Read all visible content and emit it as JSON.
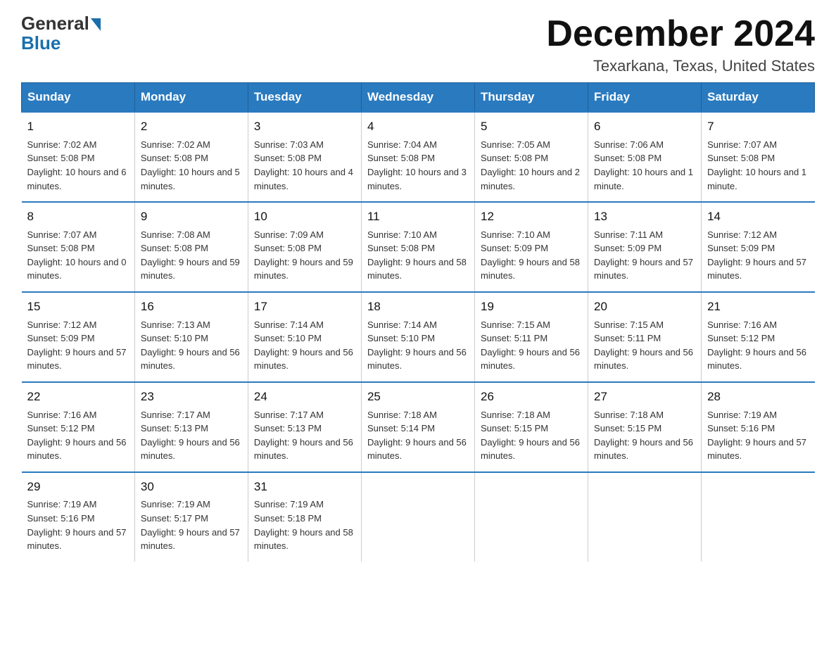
{
  "logo": {
    "general": "General",
    "blue": "Blue"
  },
  "header": {
    "month": "December 2024",
    "location": "Texarkana, Texas, United States"
  },
  "days_of_week": [
    "Sunday",
    "Monday",
    "Tuesday",
    "Wednesday",
    "Thursday",
    "Friday",
    "Saturday"
  ],
  "weeks": [
    [
      {
        "num": "1",
        "sunrise": "7:02 AM",
        "sunset": "5:08 PM",
        "daylight": "10 hours and 6 minutes."
      },
      {
        "num": "2",
        "sunrise": "7:02 AM",
        "sunset": "5:08 PM",
        "daylight": "10 hours and 5 minutes."
      },
      {
        "num": "3",
        "sunrise": "7:03 AM",
        "sunset": "5:08 PM",
        "daylight": "10 hours and 4 minutes."
      },
      {
        "num": "4",
        "sunrise": "7:04 AM",
        "sunset": "5:08 PM",
        "daylight": "10 hours and 3 minutes."
      },
      {
        "num": "5",
        "sunrise": "7:05 AM",
        "sunset": "5:08 PM",
        "daylight": "10 hours and 2 minutes."
      },
      {
        "num": "6",
        "sunrise": "7:06 AM",
        "sunset": "5:08 PM",
        "daylight": "10 hours and 1 minute."
      },
      {
        "num": "7",
        "sunrise": "7:07 AM",
        "sunset": "5:08 PM",
        "daylight": "10 hours and 1 minute."
      }
    ],
    [
      {
        "num": "8",
        "sunrise": "7:07 AM",
        "sunset": "5:08 PM",
        "daylight": "10 hours and 0 minutes."
      },
      {
        "num": "9",
        "sunrise": "7:08 AM",
        "sunset": "5:08 PM",
        "daylight": "9 hours and 59 minutes."
      },
      {
        "num": "10",
        "sunrise": "7:09 AM",
        "sunset": "5:08 PM",
        "daylight": "9 hours and 59 minutes."
      },
      {
        "num": "11",
        "sunrise": "7:10 AM",
        "sunset": "5:08 PM",
        "daylight": "9 hours and 58 minutes."
      },
      {
        "num": "12",
        "sunrise": "7:10 AM",
        "sunset": "5:09 PM",
        "daylight": "9 hours and 58 minutes."
      },
      {
        "num": "13",
        "sunrise": "7:11 AM",
        "sunset": "5:09 PM",
        "daylight": "9 hours and 57 minutes."
      },
      {
        "num": "14",
        "sunrise": "7:12 AM",
        "sunset": "5:09 PM",
        "daylight": "9 hours and 57 minutes."
      }
    ],
    [
      {
        "num": "15",
        "sunrise": "7:12 AM",
        "sunset": "5:09 PM",
        "daylight": "9 hours and 57 minutes."
      },
      {
        "num": "16",
        "sunrise": "7:13 AM",
        "sunset": "5:10 PM",
        "daylight": "9 hours and 56 minutes."
      },
      {
        "num": "17",
        "sunrise": "7:14 AM",
        "sunset": "5:10 PM",
        "daylight": "9 hours and 56 minutes."
      },
      {
        "num": "18",
        "sunrise": "7:14 AM",
        "sunset": "5:10 PM",
        "daylight": "9 hours and 56 minutes."
      },
      {
        "num": "19",
        "sunrise": "7:15 AM",
        "sunset": "5:11 PM",
        "daylight": "9 hours and 56 minutes."
      },
      {
        "num": "20",
        "sunrise": "7:15 AM",
        "sunset": "5:11 PM",
        "daylight": "9 hours and 56 minutes."
      },
      {
        "num": "21",
        "sunrise": "7:16 AM",
        "sunset": "5:12 PM",
        "daylight": "9 hours and 56 minutes."
      }
    ],
    [
      {
        "num": "22",
        "sunrise": "7:16 AM",
        "sunset": "5:12 PM",
        "daylight": "9 hours and 56 minutes."
      },
      {
        "num": "23",
        "sunrise": "7:17 AM",
        "sunset": "5:13 PM",
        "daylight": "9 hours and 56 minutes."
      },
      {
        "num": "24",
        "sunrise": "7:17 AM",
        "sunset": "5:13 PM",
        "daylight": "9 hours and 56 minutes."
      },
      {
        "num": "25",
        "sunrise": "7:18 AM",
        "sunset": "5:14 PM",
        "daylight": "9 hours and 56 minutes."
      },
      {
        "num": "26",
        "sunrise": "7:18 AM",
        "sunset": "5:15 PM",
        "daylight": "9 hours and 56 minutes."
      },
      {
        "num": "27",
        "sunrise": "7:18 AM",
        "sunset": "5:15 PM",
        "daylight": "9 hours and 56 minutes."
      },
      {
        "num": "28",
        "sunrise": "7:19 AM",
        "sunset": "5:16 PM",
        "daylight": "9 hours and 57 minutes."
      }
    ],
    [
      {
        "num": "29",
        "sunrise": "7:19 AM",
        "sunset": "5:16 PM",
        "daylight": "9 hours and 57 minutes."
      },
      {
        "num": "30",
        "sunrise": "7:19 AM",
        "sunset": "5:17 PM",
        "daylight": "9 hours and 57 minutes."
      },
      {
        "num": "31",
        "sunrise": "7:19 AM",
        "sunset": "5:18 PM",
        "daylight": "9 hours and 58 minutes."
      },
      null,
      null,
      null,
      null
    ]
  ]
}
